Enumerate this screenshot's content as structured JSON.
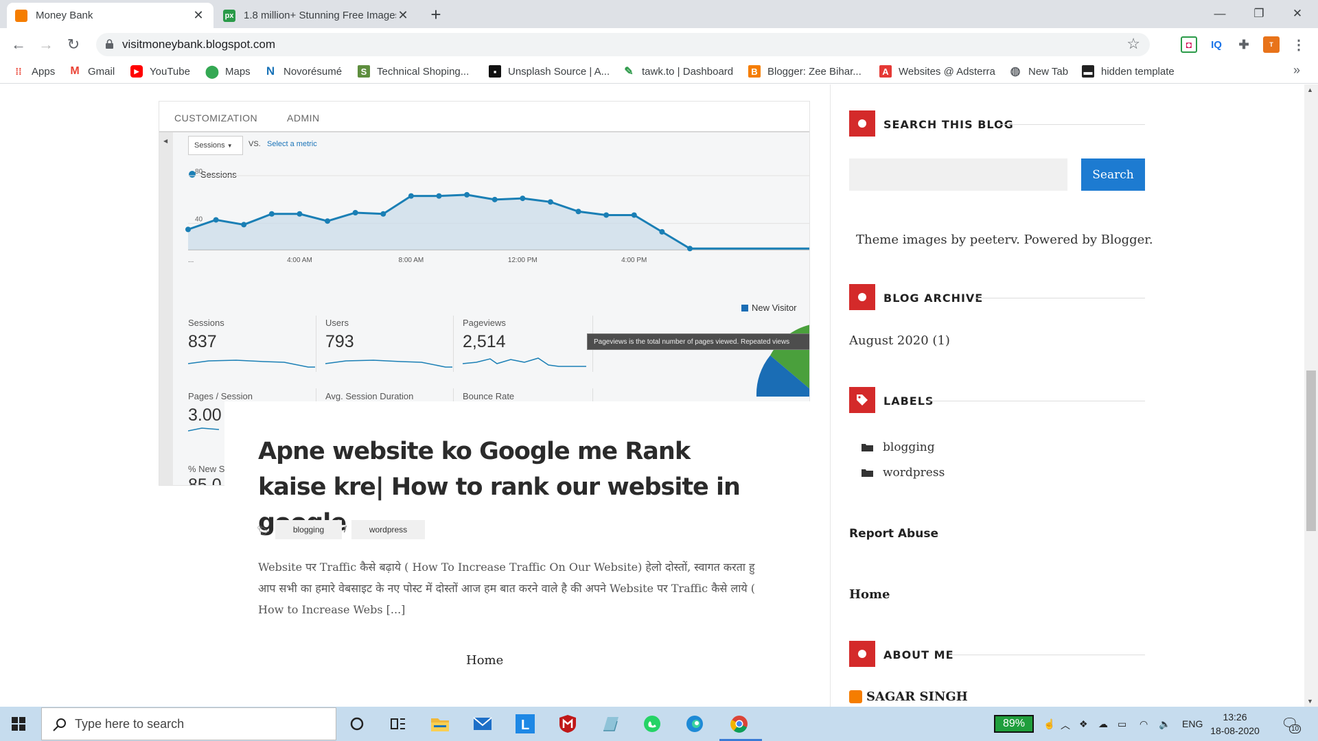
{
  "browser": {
    "tabs": [
      {
        "title": "Money Bank",
        "favicon": "blogger-icon",
        "active": true
      },
      {
        "title": "1.8 million+ Stunning Free Images",
        "favicon": "pexels-icon",
        "active": false
      }
    ],
    "url": "visitmoneybank.blogspot.com",
    "bookmarks": [
      {
        "label": "Apps",
        "icon": "apps-grid-icon"
      },
      {
        "label": "Gmail",
        "icon": "gmail-icon"
      },
      {
        "label": "YouTube",
        "icon": "youtube-icon"
      },
      {
        "label": "Maps",
        "icon": "maps-icon"
      },
      {
        "label": "Novorésumé",
        "icon": "novoresume-icon"
      },
      {
        "label": "Technical Shoping...",
        "icon": "shopify-icon"
      },
      {
        "label": "Unsplash Source | A...",
        "icon": "unsplash-icon"
      },
      {
        "label": "tawk.to | Dashboard",
        "icon": "tawk-icon"
      },
      {
        "label": "Blogger: Zee Bihar...",
        "icon": "blogger-icon"
      },
      {
        "label": "Websites @ Adsterra",
        "icon": "adsterra-icon"
      },
      {
        "label": "New Tab",
        "icon": "globe-icon"
      },
      {
        "label": "hidden template",
        "icon": "template-icon"
      }
    ],
    "extensions": [
      "pocket-icon",
      "iq-icon",
      "puzzle-icon",
      "profile-icon"
    ]
  },
  "analytics": {
    "tabs": [
      "CUSTOMIZATION",
      "ADMIN"
    ],
    "metric_select": "Sessions",
    "vs": "VS.",
    "select_metric": "Select a metric",
    "legend": "Sessions",
    "legend2": "New Visitor",
    "tooltip": "Pageviews is the total number of pages viewed. Repeated views",
    "metrics": [
      {
        "label": "Sessions",
        "value": "837"
      },
      {
        "label": "Users",
        "value": "793"
      },
      {
        "label": "Pageviews",
        "value": "2,514"
      },
      {
        "label": "Pages / Session",
        "value": "3.00"
      },
      {
        "label": "Avg. Session Duration",
        "value": ""
      },
      {
        "label": "Bounce Rate",
        "value": ""
      },
      {
        "label": "% New S",
        "value": "85.0"
      }
    ]
  },
  "chart_data": {
    "type": "line",
    "series": [
      {
        "name": "Sessions",
        "values": [
          35,
          43,
          39,
          48,
          48,
          42,
          49,
          48,
          63,
          63,
          64,
          60,
          61,
          58,
          50,
          47,
          47,
          33,
          19
        ]
      }
    ],
    "x": [
      "...",
      "",
      "",
      "",
      "4:00 AM",
      "",
      "",
      "",
      "8:00 AM",
      "",
      "",
      "",
      "12:00 PM",
      "",
      "",
      "",
      "4:00 PM",
      "",
      ""
    ],
    "xticks": [
      "...",
      "4:00 AM",
      "8:00 AM",
      "12:00 PM",
      "4:00 PM"
    ],
    "yticks": [
      "80",
      "40"
    ],
    "ylim": [
      18,
      80
    ],
    "color": "#1a7fb5"
  },
  "post": {
    "title": "Apne website ko Google me Rank kaise kre| How to rank our website in google",
    "tags": [
      "blogging",
      "wordpress"
    ],
    "tag_sep": "/",
    "excerpt": "Website पर Traffic कैसे बढ़ाये ( How To Increase Traffic On Our Website)  हेलो दोस्तों, स्वागत करता हु आप सभी का हमारे वेबसाइट के नए पोस्ट में दोस्तों आज हम बात करने वाले है की अपने Website पर Traffic कैसे लाये ( How to Increase Webs [...]",
    "home": "Home"
  },
  "sidebar": {
    "search_title": "SEARCH THIS BLOG",
    "search_button": "Search",
    "search_placeholder": "",
    "attribution": "Theme images by peeterv. Powered by Blogger.",
    "archive_title": "BLOG ARCHIVE",
    "archive_item": "August 2020 (1)",
    "labels_title": "LABELS",
    "labels": [
      "blogging",
      "wordpress"
    ],
    "report_abuse": "Report Abuse",
    "home": "Home",
    "about_title": "ABOUT ME",
    "author": "SAGAR SINGH"
  },
  "taskbar": {
    "search_placeholder": "Type here to search",
    "battery": "89%",
    "language": "ENG",
    "time": "13:26",
    "date": "18-08-2020",
    "notifications": "10",
    "accent": "#1f9e3c"
  }
}
